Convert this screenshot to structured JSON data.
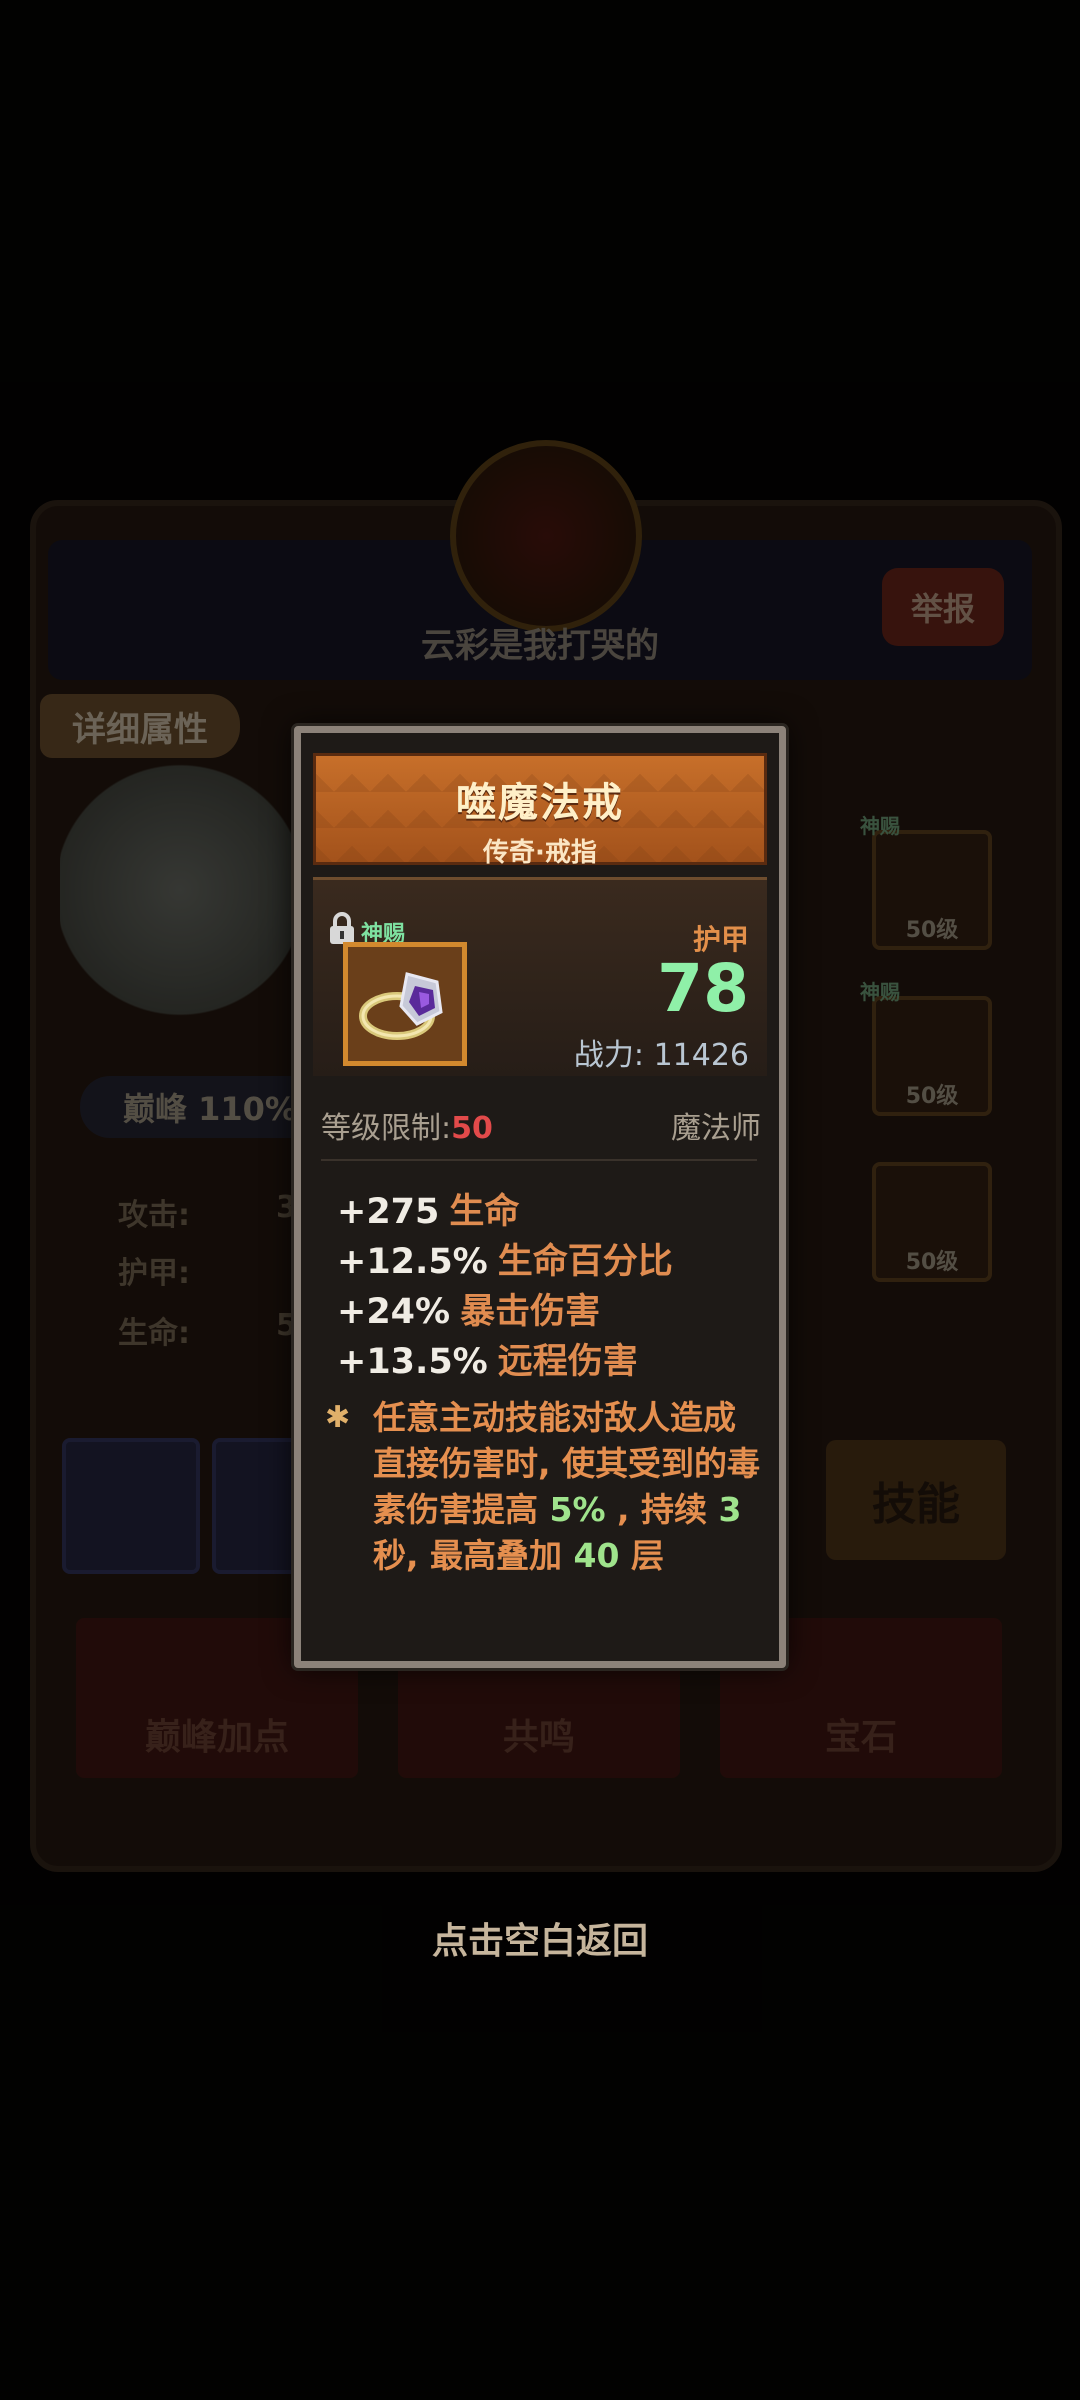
{
  "background": {
    "player_name": "云彩是我打哭的",
    "report_button": "举报",
    "detail_tab": "详细属性",
    "peak_badge": "巅峰 110%",
    "stat_labels": [
      "攻击:",
      "护甲:",
      "生命:"
    ],
    "stat_values_partial": [
      "3",
      "",
      "5"
    ],
    "slots": [
      {
        "tag": "神赐",
        "level": "50级"
      },
      {
        "tag": "神赐",
        "level": "50级"
      },
      {
        "tag": "",
        "level": "50级"
      }
    ],
    "skill_button": "技能",
    "actions": [
      "巅峰加点",
      "共鸣",
      "宝石"
    ],
    "hint": "点击空白返回"
  },
  "item": {
    "name": "噬魔法戒",
    "type": "传奇·戒指",
    "gift_tag": "神赐",
    "armor_label": "护甲",
    "armor_value": "78",
    "power_label": "战力:",
    "power_value": "11426",
    "level_req_label": "等级限制:",
    "level_req_value": "50",
    "class": "魔法师",
    "stats": [
      {
        "value": "+275",
        "name": "生命"
      },
      {
        "value": "+12.5%",
        "name": "生命百分比"
      },
      {
        "value": "+24%",
        "name": "暴击伤害"
      },
      {
        "value": "+13.5%",
        "name": "远程伤害"
      }
    ],
    "effect": {
      "p1": "任意主动技能对敌人造成直接伤害时, 使其受到的毒素伤害提高 ",
      "v1": "5%",
      "p2": " , 持续 ",
      "v2": "3",
      "p3": " 秒, 最高叠加 ",
      "v3": "40",
      "p4": " 层"
    }
  },
  "colors": {
    "title_bg": "#b65f22",
    "armor_value": "#8ff0a8",
    "level_req": "#e24a4a",
    "stat_name": "#e08c50",
    "effect": "#e58f4f",
    "highlight": "#9fe38c",
    "gift": "#7ee0a0"
  }
}
